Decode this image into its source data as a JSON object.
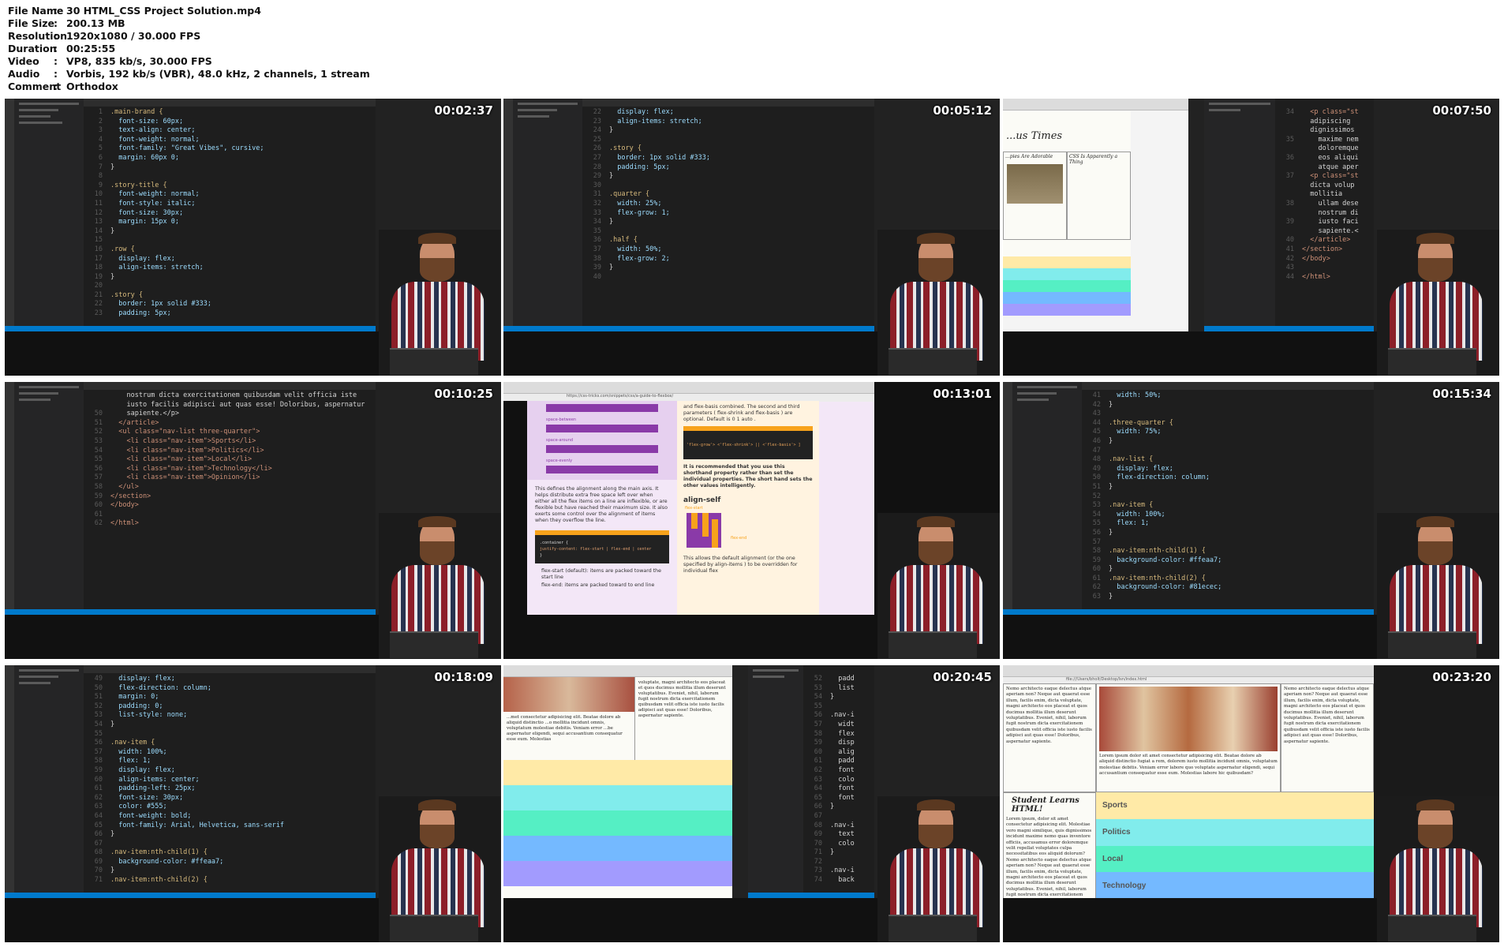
{
  "meta": [
    {
      "key": "File Name",
      "value": "30 HTML_CSS Project Solution.mp4"
    },
    {
      "key": "File Size",
      "value": "200.13 MB"
    },
    {
      "key": "Resolution",
      "value": "1920x1080 / 30.000 FPS"
    },
    {
      "key": "Duration",
      "value": "00:25:55"
    },
    {
      "key": "Video",
      "value": "VP8, 835 kb/s, 30.000 FPS"
    },
    {
      "key": "Audio",
      "value": "Vorbis, 192 kb/s (VBR), 48.0 kHz, 2 channels, 1 stream"
    },
    {
      "key": "Comment",
      "value": "Orthodox"
    }
  ],
  "thumbs": [
    {
      "time": "00:02:37",
      "lines": [
        [
          "1",
          ".main-brand {"
        ],
        [
          "2",
          "  font-size: 60px;"
        ],
        [
          "3",
          "  text-align: center;"
        ],
        [
          "4",
          "  font-weight: normal;"
        ],
        [
          "5",
          "  font-family: \"Great Vibes\", cursive;"
        ],
        [
          "6",
          "  margin: 60px 0;"
        ],
        [
          "7",
          "}"
        ],
        [
          "8",
          ""
        ],
        [
          "9",
          ".story-title {"
        ],
        [
          "10",
          "  font-weight: normal;"
        ],
        [
          "11",
          "  font-style: italic;"
        ],
        [
          "12",
          "  font-size: 30px;"
        ],
        [
          "13",
          "  margin: 15px 0;"
        ],
        [
          "14",
          "}"
        ],
        [
          "15",
          ""
        ],
        [
          "16",
          ".row {"
        ],
        [
          "17",
          "  display: flex;"
        ],
        [
          "18",
          "  align-items: stretch;"
        ],
        [
          "19",
          "}"
        ],
        [
          "20",
          ""
        ],
        [
          "21",
          ".story {"
        ],
        [
          "22",
          "  border: 1px solid #333;"
        ],
        [
          "23",
          "  padding: 5px;"
        ]
      ]
    },
    {
      "time": "00:05:12",
      "lines": [
        [
          "22",
          "  display: flex;"
        ],
        [
          "23",
          "  align-items: stretch;"
        ],
        [
          "24",
          "}"
        ],
        [
          "25",
          ""
        ],
        [
          "26",
          ".story {"
        ],
        [
          "27",
          "  border: 1px solid #333;"
        ],
        [
          "28",
          "  padding: 5px;"
        ],
        [
          "29",
          "}"
        ],
        [
          "30",
          ""
        ],
        [
          "31",
          ".quarter {"
        ],
        [
          "32",
          "  width: 25%;"
        ],
        [
          "33",
          "  flex-grow: 1;"
        ],
        [
          "34",
          "}"
        ],
        [
          "35",
          ""
        ],
        [
          "36",
          ".half {"
        ],
        [
          "37",
          "  width: 50%;"
        ],
        [
          "38",
          "  flex-grow: 2;"
        ],
        [
          "39",
          "}"
        ],
        [
          "40",
          ""
        ]
      ]
    },
    {
      "time": "00:07:50",
      "lines": [
        [
          "34",
          "  <p class=\"st"
        ],
        [
          "",
          "  adipiscing"
        ],
        [
          "",
          "  dignissimos"
        ],
        [
          "35",
          "    maxime nem"
        ],
        [
          "",
          "    doloremque"
        ],
        [
          "36",
          "    eos aliqui"
        ],
        [
          "",
          "    atque aper"
        ],
        [
          "37",
          "  <p class=\"st"
        ],
        [
          "",
          "  dicta volup"
        ],
        [
          "",
          "  mollitia"
        ],
        [
          "38",
          "    ullam dese"
        ],
        [
          "",
          "    nostrum di"
        ],
        [
          "39",
          "    iusto faci"
        ],
        [
          "",
          "    sapiente.<"
        ],
        [
          "40",
          "  </article>"
        ],
        [
          "41",
          "</section>"
        ],
        [
          "42",
          "</body>"
        ],
        [
          "43",
          ""
        ],
        [
          "44",
          "</html>"
        ]
      ],
      "browser_title": "...us Times",
      "story_left": "...pies Are Adorable",
      "story_right": "CSS Is Apparently a Thing"
    },
    {
      "time": "00:10:25",
      "lines": [
        [
          "",
          "    nostrum dicta exercitationem quibusdam velit officia iste"
        ],
        [
          "",
          "    iusto facilis adipisci aut quas esse! Doloribus, aspernatur"
        ],
        [
          "50",
          "    sapiente.</p>"
        ],
        [
          "51",
          "  </article>"
        ],
        [
          "52",
          "  <ul class=\"nav-list three-quarter\">"
        ],
        [
          "53",
          "    <li class=\"nav-item\">Sports</li>"
        ],
        [
          "54",
          "    <li class=\"nav-item\">Politics</li>"
        ],
        [
          "55",
          "    <li class=\"nav-item\">Local</li>"
        ],
        [
          "56",
          "    <li class=\"nav-item\">Technology</li>"
        ],
        [
          "57",
          "    <li class=\"nav-item\">Opinion</li>"
        ],
        [
          "58",
          "  </ul>"
        ],
        [
          "59",
          "</section>"
        ],
        [
          "60",
          "</body>"
        ],
        [
          "61",
          ""
        ],
        [
          "62",
          "</html>"
        ]
      ]
    },
    {
      "time": "00:13:01",
      "url": "https://css-tricks.com/snippets/css/a-guide-to-flexbox/",
      "labels": [
        "space-between",
        "space-around",
        "space-evenly"
      ],
      "para1": "This defines the alignment along the main axis. It helps distribute extra free space left over when either all the flex items on a line are inflexible, or are flexible but have reached their maximum size. It also exerts some control over the alignment of items when they overflow the line.",
      "code1": ".container {",
      "code2": "  justify-content: flex-start | flex-end | center",
      "li1": "flex-start (default): items are packed toward the start line",
      "li2": "flex-end: items are packed toward to end line",
      "right1": "and flex-basis combined. The second and third parameters ( flex-shrink and flex-basis ) are optional. Default is 0 1 auto .",
      "right_code": "  'flex-grow'> <'flex-shrink'> || <'flex-basis'> ]",
      "right2": "It is recommended that you use this shorthand property rather than set the individual properties. The short hand sets the other values intelligently.",
      "align_title": "align-self",
      "flex_start": "flex-start",
      "flex_end": "flex-end",
      "right3": "This allows the default alignment (or the one specified by align-items ) to be overridden for individual flex"
    },
    {
      "time": "00:15:34",
      "lines": [
        [
          "41",
          "  width: 50%;"
        ],
        [
          "42",
          "}"
        ],
        [
          "43",
          ""
        ],
        [
          "44",
          ".three-quarter {"
        ],
        [
          "45",
          "  width: 75%;"
        ],
        [
          "46",
          "}"
        ],
        [
          "47",
          ""
        ],
        [
          "48",
          ".nav-list {"
        ],
        [
          "49",
          "  display: flex;"
        ],
        [
          "50",
          "  flex-direction: column;"
        ],
        [
          "51",
          "}"
        ],
        [
          "52",
          ""
        ],
        [
          "53",
          ".nav-item {"
        ],
        [
          "54",
          "  width: 100%;"
        ],
        [
          "55",
          "  flex: 1;"
        ],
        [
          "56",
          "}"
        ],
        [
          "57",
          ""
        ],
        [
          "58",
          ".nav-item:nth-child(1) {"
        ],
        [
          "59",
          "  background-color: #ffeaa7;"
        ],
        [
          "60",
          "}"
        ],
        [
          "61",
          ".nav-item:nth-child(2) {"
        ],
        [
          "62",
          "  background-color: #81ecec;"
        ],
        [
          "63",
          "}"
        ]
      ]
    },
    {
      "time": "00:18:09",
      "lines": [
        [
          "49",
          "  display: flex;"
        ],
        [
          "50",
          "  flex-direction: column;"
        ],
        [
          "51",
          "  margin: 0;"
        ],
        [
          "52",
          "  padding: 0;"
        ],
        [
          "53",
          "  list-style: none;"
        ],
        [
          "54",
          "}"
        ],
        [
          "55",
          ""
        ],
        [
          "56",
          ".nav-item {"
        ],
        [
          "57",
          "  width: 100%;"
        ],
        [
          "58",
          "  flex: 1;"
        ],
        [
          "59",
          "  display: flex;"
        ],
        [
          "60",
          "  align-items: center;"
        ],
        [
          "61",
          "  padding-left: 25px;"
        ],
        [
          "62",
          "  font-size: 30px;"
        ],
        [
          "63",
          "  color: #555;"
        ],
        [
          "64",
          "  font-weight: bold;"
        ],
        [
          "65",
          "  font-family: Arial, Helvetica, sans-serif"
        ],
        [
          "66",
          "}"
        ],
        [
          "67",
          ""
        ],
        [
          "68",
          ".nav-item:nth-child(1) {"
        ],
        [
          "69",
          "  background-color: #ffeaa7;"
        ],
        [
          "70",
          "}"
        ],
        [
          "71",
          ".nav-item:nth-child(2) {"
        ]
      ]
    },
    {
      "time": "00:20:45",
      "lines": [
        [
          "52",
          "  padd"
        ],
        [
          "53",
          "  list"
        ],
        [
          "54",
          "}"
        ],
        [
          "55",
          ""
        ],
        [
          "56",
          ".nav-i"
        ],
        [
          "57",
          "  widt"
        ],
        [
          "58",
          "  flex"
        ],
        [
          "59",
          "  disp"
        ],
        [
          "60",
          "  alig"
        ],
        [
          "61",
          "  padd"
        ],
        [
          "62",
          "  font"
        ],
        [
          "63",
          "  colo"
        ],
        [
          "64",
          "  font"
        ],
        [
          "65",
          "  font"
        ],
        [
          "66",
          "}"
        ],
        [
          "67",
          ""
        ],
        [
          "68",
          ".nav-i"
        ],
        [
          "69",
          "  text"
        ],
        [
          "70",
          "  colo"
        ],
        [
          "71",
          "}"
        ],
        [
          "72",
          ""
        ],
        [
          "73",
          ".nav-i"
        ],
        [
          "74",
          "  back"
        ]
      ],
      "text_a": "...met consectetur adipisicing elit. Beatae dolore ab aliquid distinctio ...o mollitia incidunt omnis, voluptatum molestiae debitis. Veniam error ...be aspernatur eligendi, sequi accusantium consequatur esse eum. Molestias",
      "text_b": "voluptate, magni architecto eos placeat et quos ducimus mollitia illum deserunt voluptatibus. Eveniet, nihil, laborum fugit nostrum dicta exercitationem quibusdam velit officia iste iusto facilis adipisci aut quas esse! Doloribus, aspernatur sapiente."
    },
    {
      "time": "00:23:20",
      "url": "file:///Users/bholt/Desktop/lsn/index.html",
      "col_left": "Nemo architecto eaque delectus atque aperiam non? Neque aut quaerat esse illum, facilis enim, dicta voluptate, magni architecto eos placeat et quos ducimus mollitia illum deserunt voluptatibus. Eveniet, nihil, laborum fugit nostrum dicta exercitationem quibusdam velit officia iste iusto facilis adipisci aut quas esse! Doloribus, aspernatur sapiente.",
      "col_mid": "Lorem ipsum dolor sit amet consectetur adipisicing elit. Beatae dolore ab aliquid distinctio fugiat a rem, dolorem iusto mollitia incidunt omnis, voluptatum molestiae debitis. Veniam error labore quo voluptate aspernatur eligendi, sequi accusantium consequatur esse eum. Molestias labore hic quibusdam?",
      "col_right": "Nemo architecto eaque delectus atque aperiam non? Neque aut quaerat esse illum, facilis enim, dicta voluptate, magni architecto eos placeat et quos ducimus mollitia illum deserunt voluptatibus. Eveniet, nihil, laborum fugit nostrum dicta exercitationem quibusdam velit officia iste iusto facilis adipisci aut quas esse! Doloribus, aspernatur sapiente.",
      "student_title": "Student Learns HTML!",
      "student_text": "Lorem ipsum, dolor sit amet consectetur adipisicing elit. Molestiae vero magni similique, quis dignissimos incidunt maxime nemo quas inventore officiis, accusamus error doloremque velit repellat voluptates culpa necessitatibus eos aliquid dolorum? Nemo architecto eaque delectus atque aperiam non? Neque aut quaerat esse illum, facilis enim, dicta voluptate, magni architecto eos placeat et quos ducimus mollitia illum deserunt voluptatibus. Eveniet, nihil, laborum fugit nostrum dicta exercitationem quibusdam velit officia iste iusto",
      "nav": [
        {
          "label": "Sports",
          "color": "#ffeaa7"
        },
        {
          "label": "Politics",
          "color": "#81ecec"
        },
        {
          "label": "Local",
          "color": "#55efc4"
        },
        {
          "label": "Technology",
          "color": "#74b9ff"
        }
      ]
    }
  ]
}
